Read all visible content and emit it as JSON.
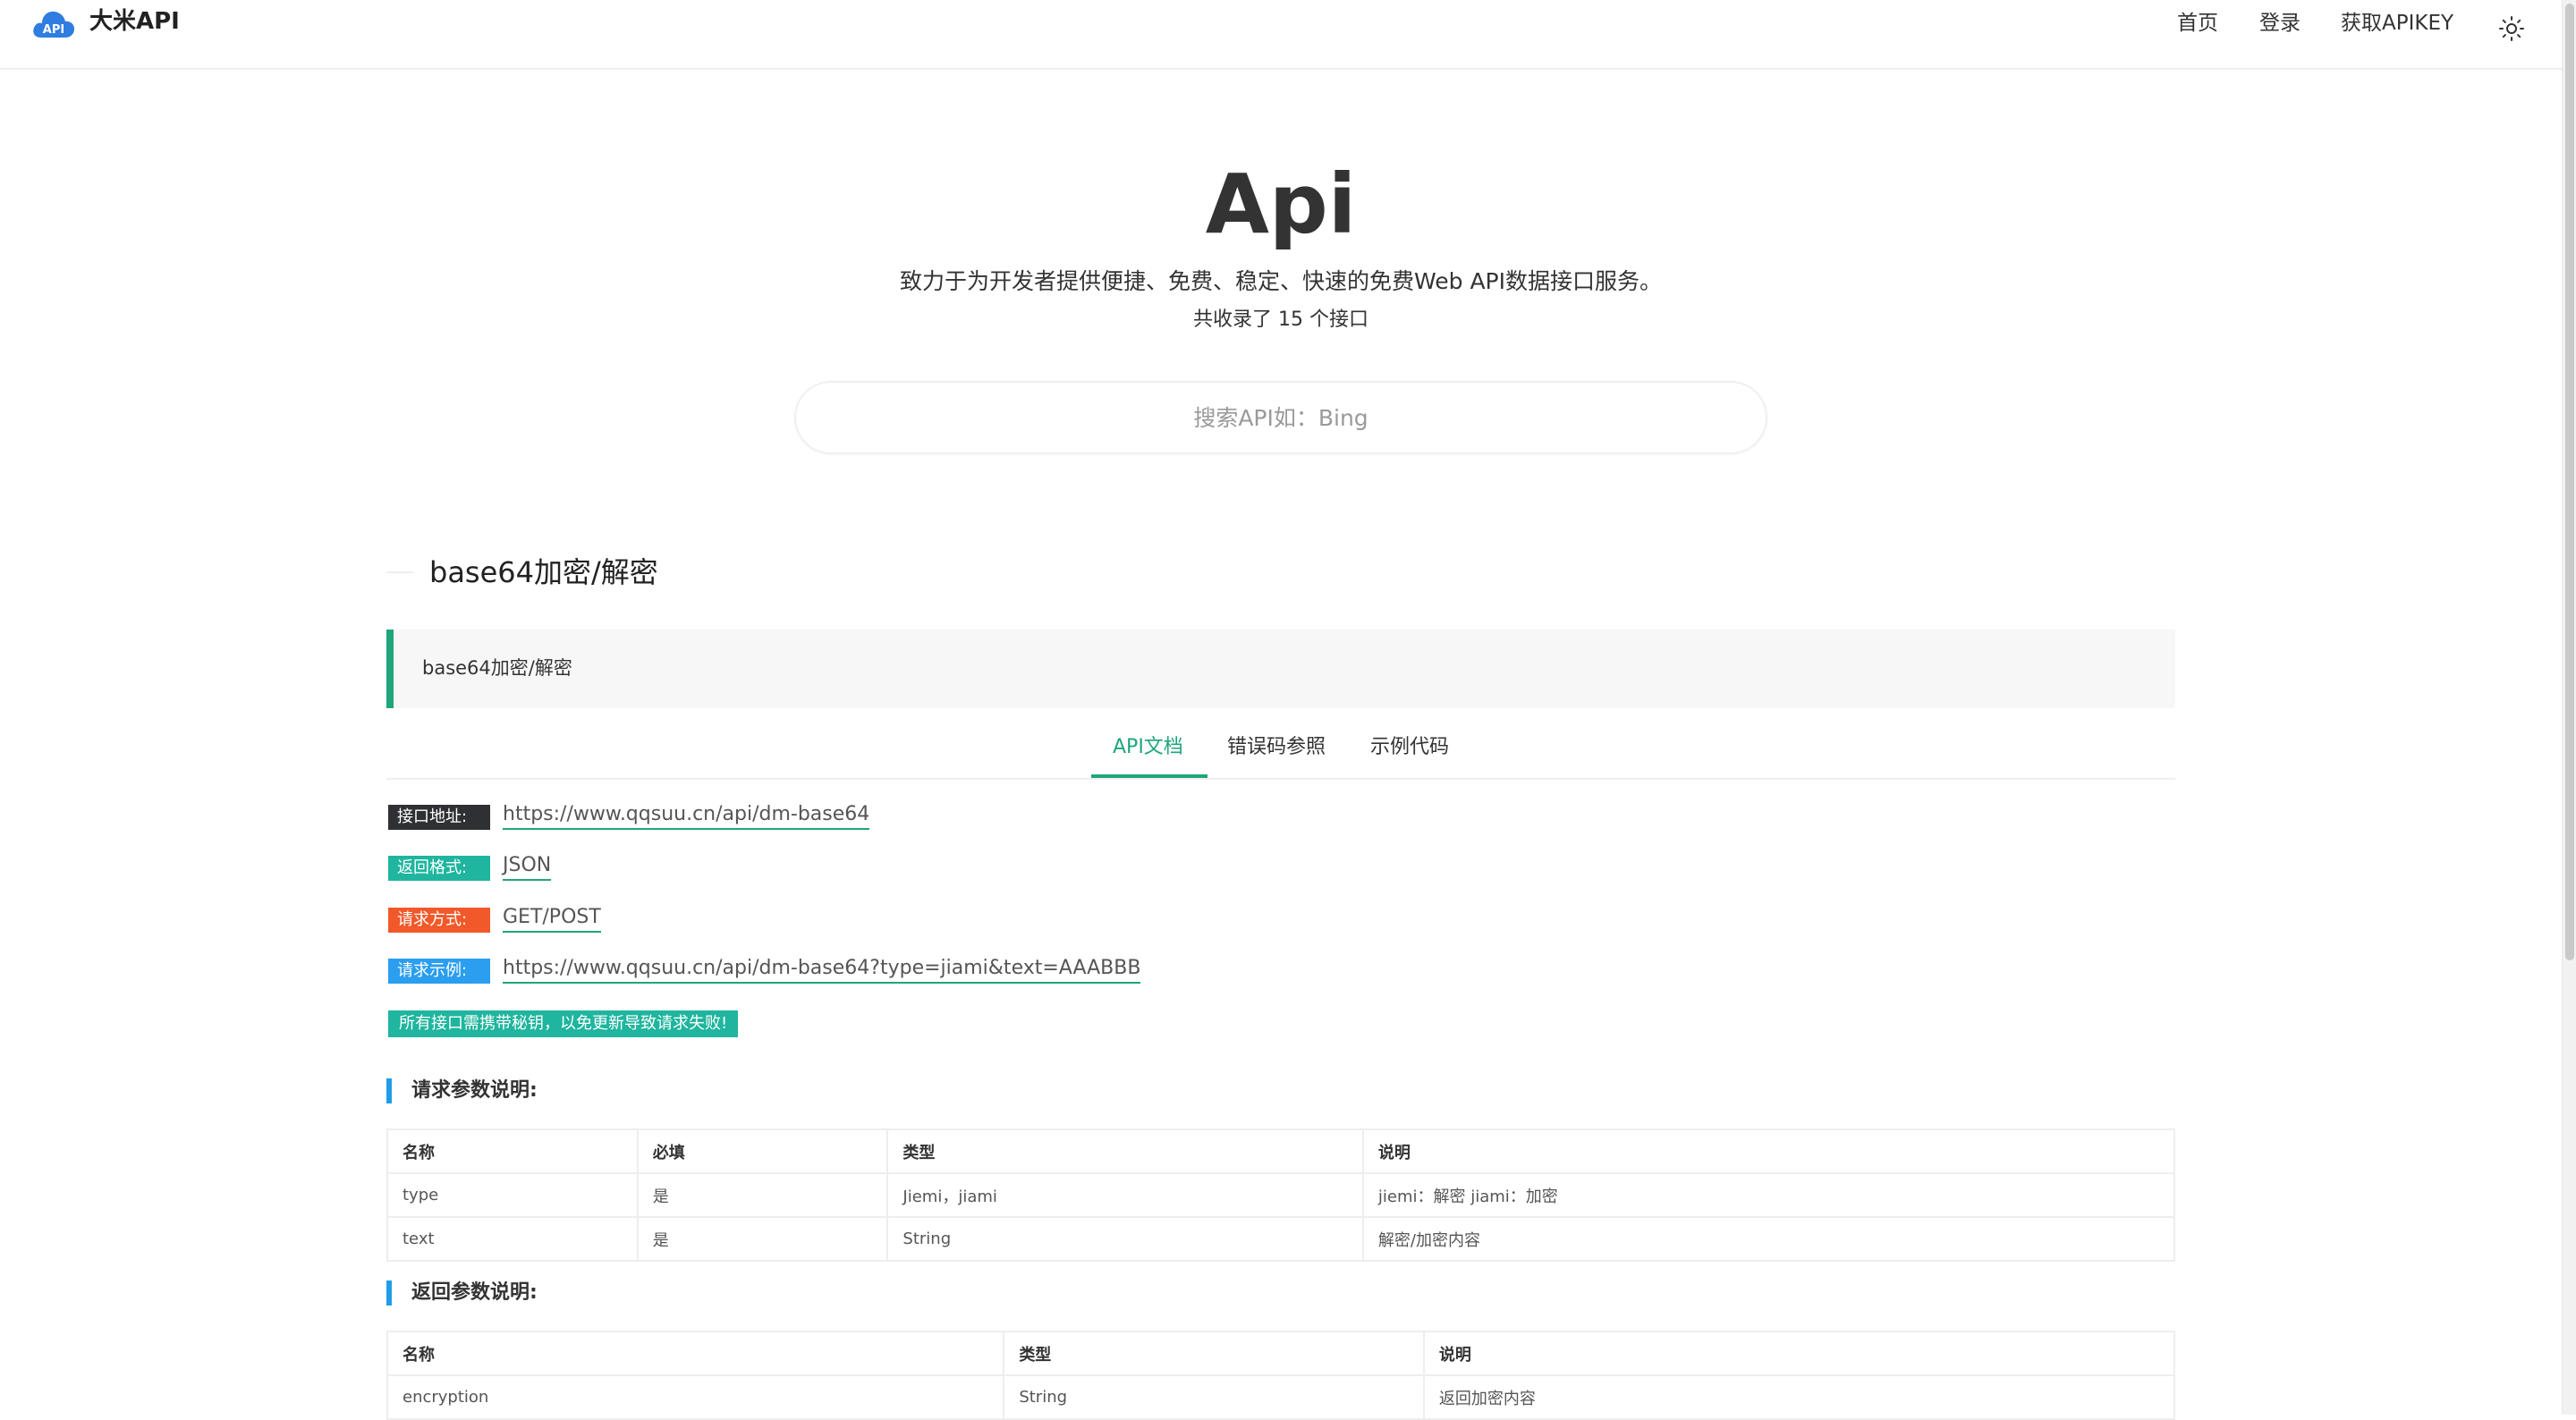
{
  "header": {
    "brand": "大米API",
    "logo_icon": "cloud-api-logo",
    "nav": {
      "home": "首页",
      "login": "登录",
      "apikey": "获取APIKEY"
    },
    "theme_icon": "sun-icon"
  },
  "hero": {
    "title": "Api",
    "subtitle": "致力于为开发者提供便捷、免费、稳定、快速的免费Web API数据接口服务。",
    "count": "共收录了 15 个接口"
  },
  "search": {
    "placeholder": "搜索API如：Bing",
    "value": ""
  },
  "api": {
    "name": "base64加密/解密",
    "description": "base64加密/解密",
    "tabs": [
      "API文档",
      "错误码参照",
      "示例代码"
    ],
    "active_tab": "API文档",
    "info": [
      {
        "label": "接口地址:",
        "value": "https://www.qqsuu.cn/api/dm-base64"
      },
      {
        "label": "返回格式:",
        "value": "JSON"
      },
      {
        "label": "请求方式:",
        "value": "GET/POST"
      },
      {
        "label": "请求示例:",
        "value": "https://www.qqsuu.cn/api/dm-base64?type=jiami&text=AAABBB"
      }
    ],
    "notice": "所有接口需携带秘钥，以免更新导致请求失败!",
    "request_params": {
      "title": "请求参数说明:",
      "headers": [
        "名称",
        "必填",
        "类型",
        "说明"
      ],
      "rows": [
        [
          "type",
          "是",
          "Jiemi，jiami",
          "jiemi：解密 jiami：加密"
        ],
        [
          "text",
          "是",
          "String",
          "解密/加密内容"
        ]
      ]
    },
    "response_params": {
      "title": "返回参数说明:",
      "headers": [
        "名称",
        "类型",
        "说明"
      ],
      "rows": [
        [
          "encryption",
          "String",
          "返回加密内容"
        ]
      ]
    }
  },
  "colors": {
    "accent_green": "#1fa67a",
    "badge_dark": "#2f3033",
    "badge_teal": "#1fb59e",
    "badge_orange": "#f2592a",
    "badge_blue": "#2b9eef",
    "section_marker": "#1f9ee8"
  }
}
